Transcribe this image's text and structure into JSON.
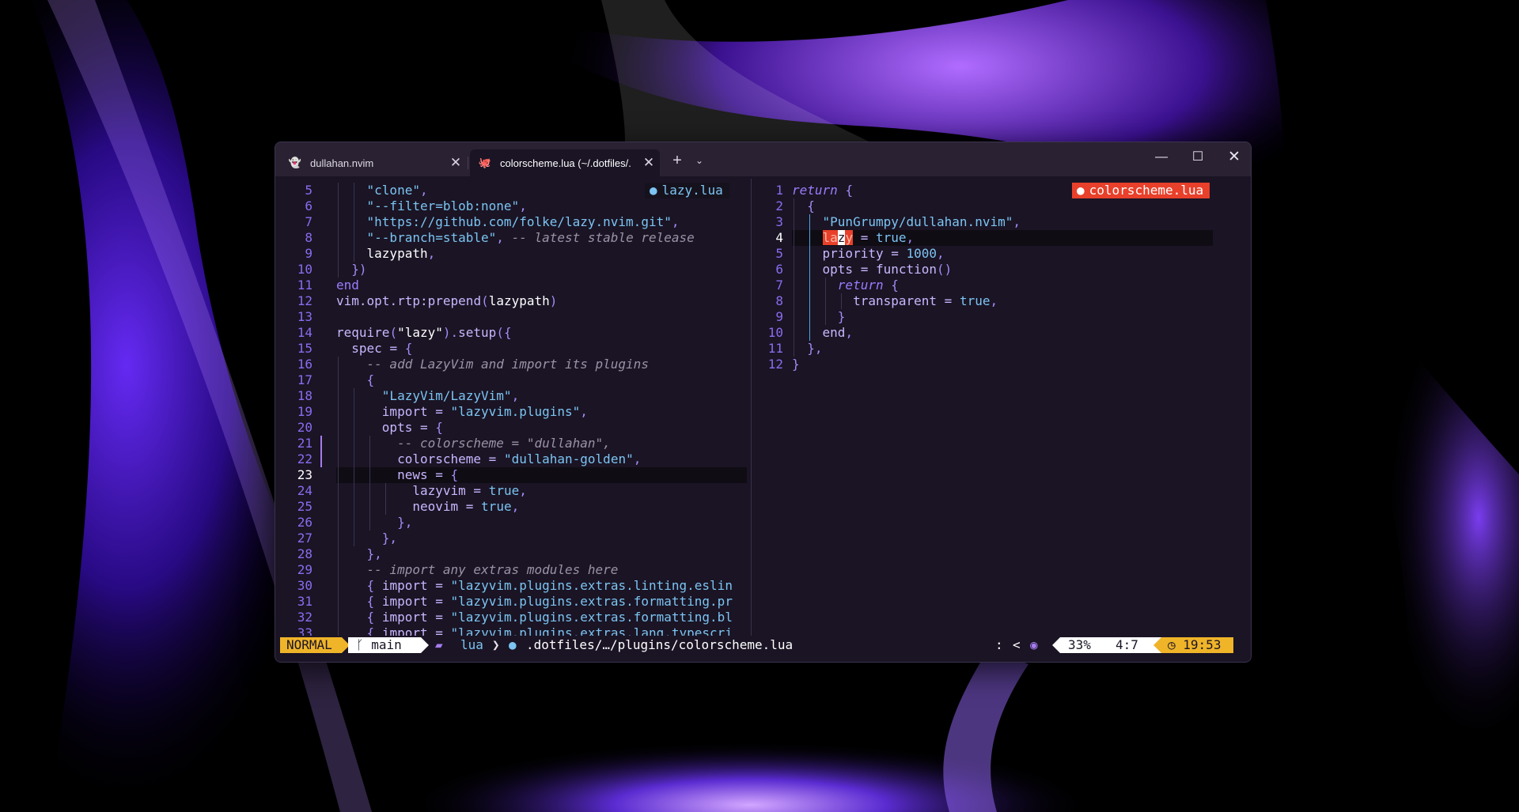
{
  "window": {
    "tabs": [
      {
        "label": "dullahan.nvim",
        "icon": "ghost-icon",
        "active": false
      },
      {
        "label": "colorscheme.lua (~/.dotfiles/.",
        "icon": "octopus-icon",
        "active": true
      }
    ],
    "new_tab_glyph": "+",
    "dropdown_glyph": "⌄",
    "minimize_glyph": "—",
    "maximize_glyph": "☐",
    "close_glyph": "✕",
    "tab_close_glyph": "✕"
  },
  "left_pane": {
    "winbar": "lazy.lua",
    "line_numbers": [
      "5",
      "6",
      "7",
      "8",
      "9",
      "10",
      "11",
      "12",
      "13",
      "14",
      "15",
      "16",
      "17",
      "18",
      "19",
      "20",
      "21",
      "22",
      "23",
      "24",
      "25",
      "26",
      "27",
      "28",
      "29",
      "30",
      "31",
      "32",
      "33"
    ],
    "cursor_line_number": "23"
  },
  "right_pane": {
    "winbar": "colorscheme.lua",
    "line_numbers": [
      "1",
      "2",
      "3",
      "4",
      "5",
      "6",
      "7",
      "8",
      "9",
      "10",
      "11",
      "12"
    ],
    "cursor_line_number": "4"
  },
  "statusline": {
    "mode": "NORMAL",
    "branch_icon": "ᚴ",
    "branch": "main",
    "filetype": "lua",
    "path": ".dotfiles/…/plugins/colorscheme.lua",
    "colon": ":",
    "lchev": "<",
    "percent": "33%",
    "position": "4:7",
    "time": "19:53"
  },
  "colors": {
    "accent": "#9c7cff",
    "mode_bg": "#f0b429",
    "search_hl": "#e8402a",
    "string": "#7cc4f2"
  }
}
